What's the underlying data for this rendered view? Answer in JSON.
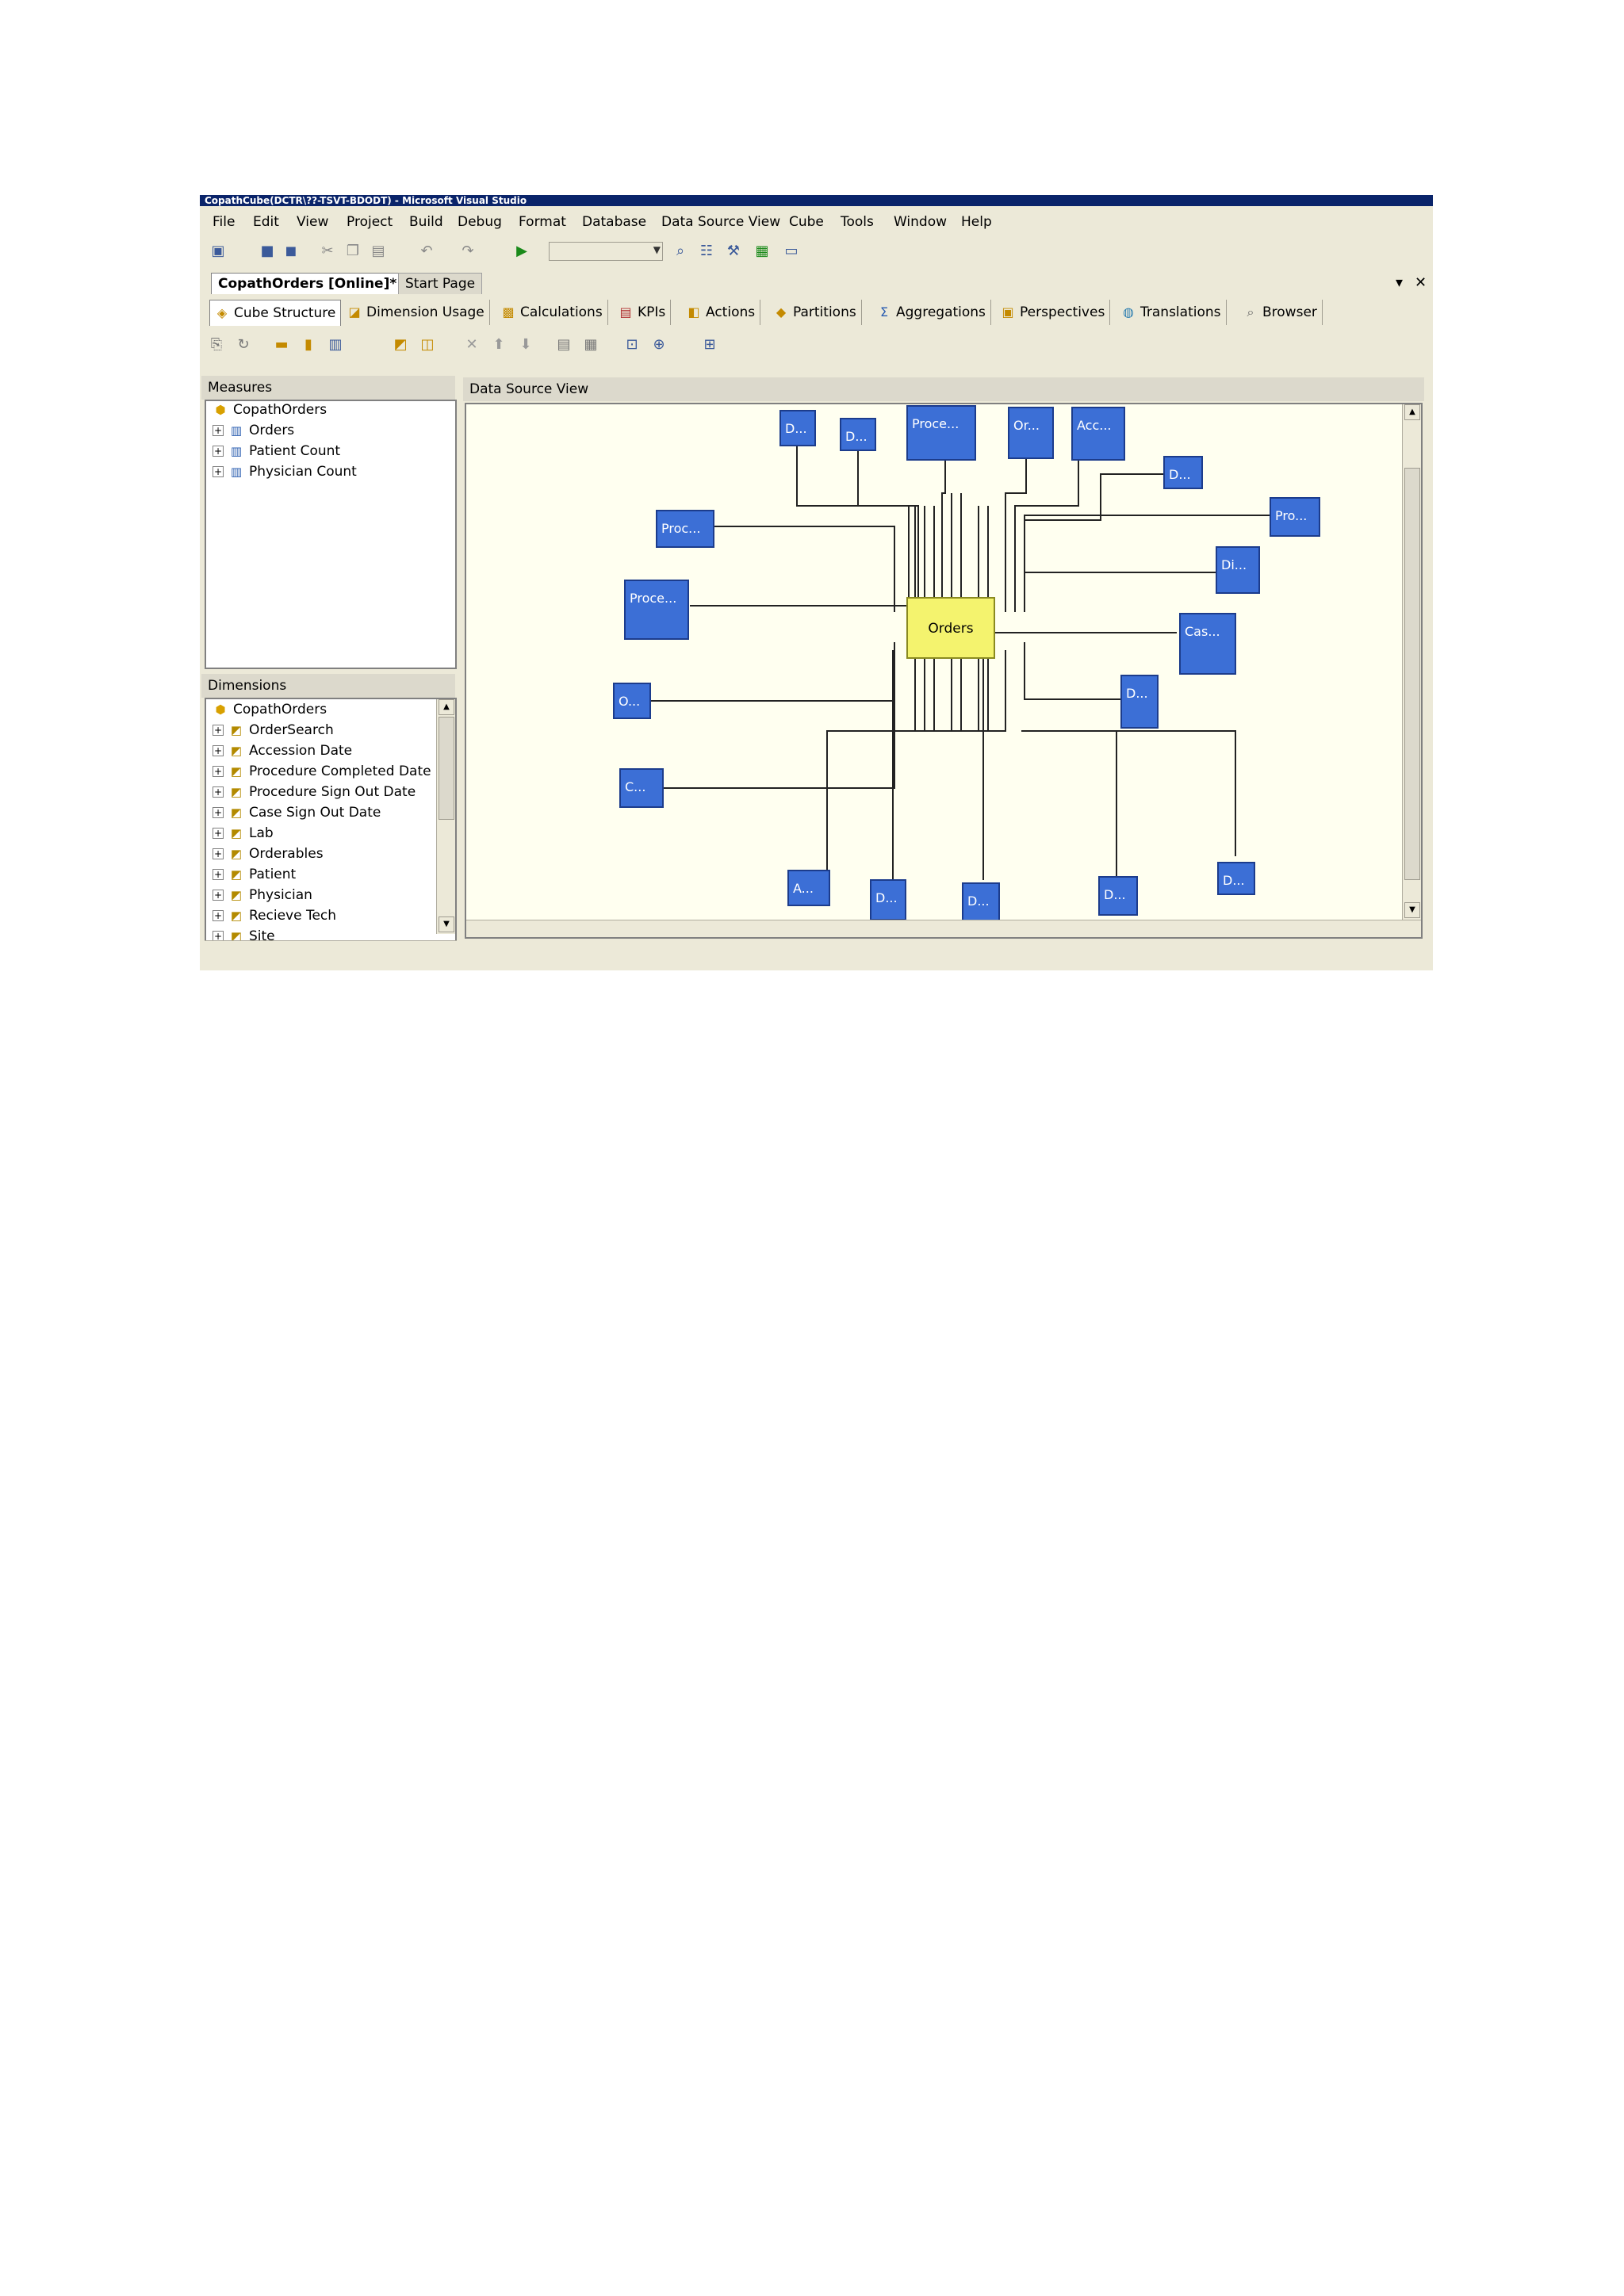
{
  "window": {
    "title": "CopathCube(DCTR\\??-TSVT-BDODT) - Microsoft Visual Studio"
  },
  "menu": [
    "File",
    "Edit",
    "View",
    "Project",
    "Build",
    "Debug",
    "Format",
    "Database",
    "Data Source View",
    "Cube",
    "Tools",
    "Window",
    "Help"
  ],
  "doc_tabs": {
    "active": "CopathOrders [Online]*",
    "inactive": "Start Page",
    "pin": "▾",
    "close": "✕"
  },
  "designer_tabs": [
    "Cube Structure",
    "Dimension Usage",
    "Calculations",
    "KPIs",
    "Actions",
    "Partitions",
    "Aggregations",
    "Perspectives",
    "Translations",
    "Browser"
  ],
  "measures": {
    "header": "Measures",
    "root": "CopathOrders",
    "items": [
      "Orders",
      "Patient Count",
      "Physician Count"
    ]
  },
  "dimensions": {
    "header": "Dimensions",
    "root": "CopathOrders",
    "items": [
      "OrderSearch",
      "Accession Date",
      "Procedure Completed Date",
      "Procedure Sign Out Date",
      "Case Sign Out Date",
      "Lab",
      "Orderables",
      "Patient",
      "Physician",
      "Recieve Tech",
      "Site"
    ]
  },
  "dsv": {
    "header": "Data Source View",
    "central": "Orders",
    "tables": [
      "D...",
      "D...",
      "Proce...",
      "Or...",
      "Acc...",
      "D...",
      "Pro...",
      "Di...",
      "Cas...",
      "D...",
      "Proc...",
      "Proce...",
      "O...",
      "C...",
      "A...",
      "D...",
      "D...",
      "D...",
      "D..."
    ]
  },
  "colors": {
    "table_fill": "#3c6fd6",
    "central_fill": "#f4f36e",
    "canvas": "#fffff0",
    "title_bar": "#0a246a"
  }
}
